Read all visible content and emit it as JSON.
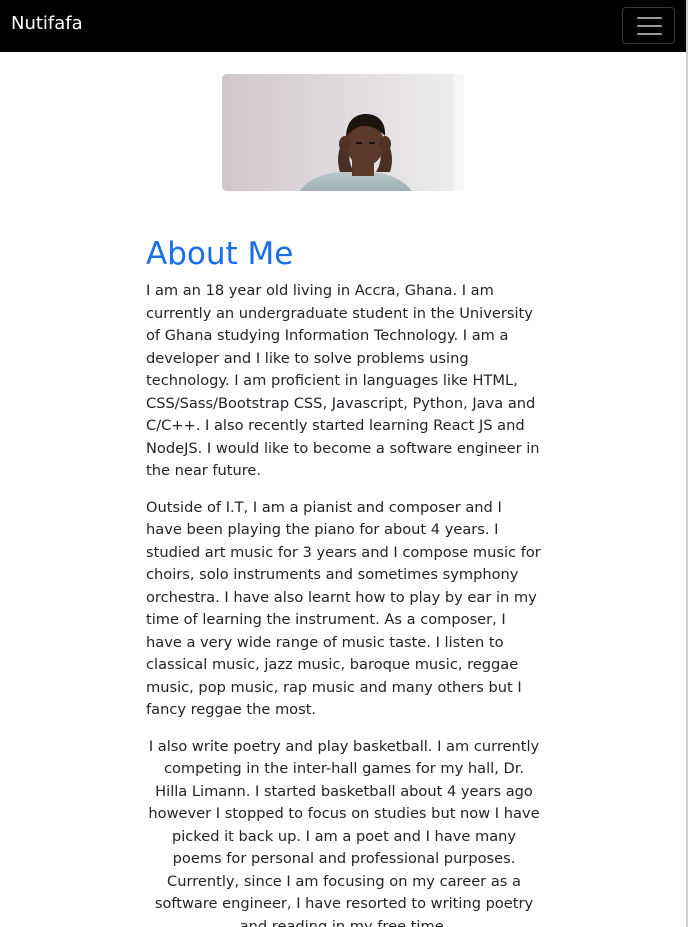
{
  "navbar": {
    "brand": "Nutifafa",
    "toggle_icon": "hamburger-menu-icon"
  },
  "profile_photo": {
    "description_icon": "profile-photo"
  },
  "about": {
    "heading": "About Me",
    "paragraphs": [
      "I am an 18 year old living in Accra, Ghana. I am currently an undergraduate student in the University of Ghana studying Information Technology. I am a developer and I like to solve problems using technology. I am proficient in languages like HTML, CSS/Sass/Bootstrap CSS, Javascript, Python, Java and C/C++. I also recently started learning React JS and NodeJS. I would like to become a software engineer in the near future.",
      "Outside of I.T, I am a pianist and composer and I have been playing the piano for about 4 years. I studied art music for 3 years and I compose music for choirs, solo instruments and sometimes symphony orchestra. I have also learnt how to play by ear in my time of learning the instrument. As a composer, I have a very wide range of music taste. I listen to classical music, jazz music, baroque music, reggae music, pop music, rap music and many others but I fancy reggae the most.",
      "I also write poetry and play basketball. I am currently competing in the inter-hall games for my hall, Dr. Hilla Limann. I started basketball about 4 years ago however I stopped to focus on studies but now I have picked it back up. I am a poet and I have many poems for personal and professional purposes. Currently, since I am focusing on my career as a software engineer, I have resorted to writing poetry and reading in my free time."
    ]
  },
  "colors": {
    "navbar_bg": "#000000",
    "heading": "#1a6fe8",
    "body_text": "#212529"
  }
}
